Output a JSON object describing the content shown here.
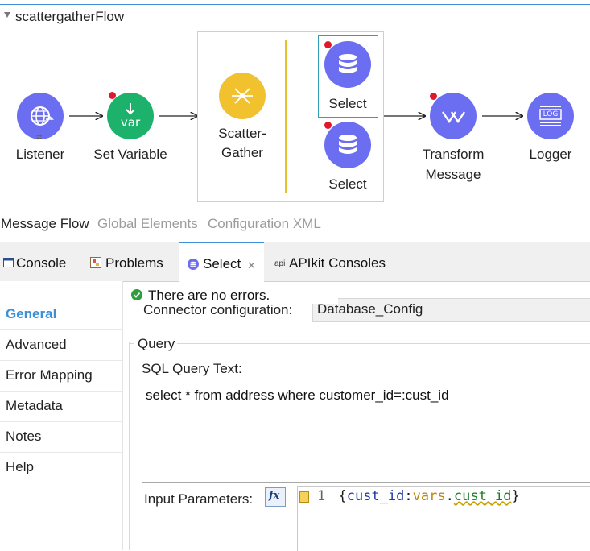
{
  "flow": {
    "title": "scattergatherFlow",
    "nodes": {
      "listener": "Listener",
      "set_variable": "Set Variable",
      "scatter_gather": [
        "Scatter-",
        "Gather"
      ],
      "select_1": "Select",
      "select_2": "Select",
      "transform": [
        "Transform",
        "Message"
      ],
      "logger": "Logger"
    },
    "var_icon_text": "var",
    "log_icon_text": "LOG",
    "colors": {
      "http_blue": "#6b6ef0",
      "set_var_green": "#1db26b",
      "scatter_gold": "#f2c12e",
      "db_purple": "#6b6ef0",
      "error_dot": "#e0182d"
    }
  },
  "editor_tabs": [
    "Message Flow",
    "Global Elements",
    "Configuration XML"
  ],
  "panel_tabs": [
    {
      "label": "Console",
      "icon": "console-icon"
    },
    {
      "label": "Problems",
      "icon": "problems-icon"
    },
    {
      "label": "Select",
      "icon": "database-icon",
      "active": true
    },
    {
      "label": "APIkit Consoles",
      "icon": "api-icon",
      "icon_text": "api"
    }
  ],
  "sidebar": {
    "items": [
      "General",
      "Advanced",
      "Error Mapping",
      "Metadata",
      "Notes",
      "Help"
    ],
    "active": "General"
  },
  "properties": {
    "status": "There are no errors.",
    "connector_label": "Connector configuration:",
    "connector_value": "Database_Config",
    "query_group": "Query",
    "sql_label": "SQL Query Text:",
    "sql_text": "select * from address where customer_id=:cust_id",
    "input_params_label": "Input Parameters:",
    "fx_label": "fx",
    "code_line_number": "1",
    "code": {
      "open": "{",
      "key": "cust_id",
      "colon": ":",
      "vars": "vars",
      "dot": ".",
      "field": "cust_id",
      "close": "}"
    }
  }
}
